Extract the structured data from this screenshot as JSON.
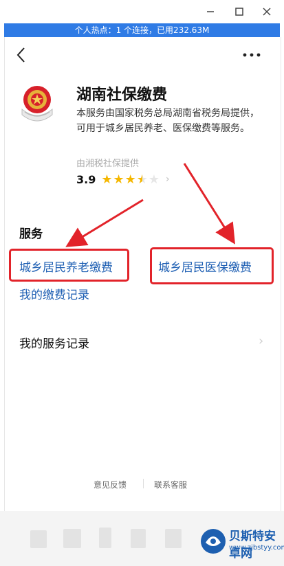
{
  "hotspot_bar": {
    "text": "个人热点：1 个连接，已用232.63M"
  },
  "app": {
    "title": "湖南社保缴费",
    "description": "本服务由国家税务总局湖南省税务局提供，可用于城乡居民养老、医保缴费等服务。",
    "provider": "由湘税社保提供",
    "rating": "3.9",
    "rating_value": 3.9,
    "rating_max": 5
  },
  "services": {
    "section_title": "服务",
    "pension_payment": "城乡居民养老缴费",
    "medical_payment": "城乡居民医保缴费",
    "payment_records": "我的缴费记录"
  },
  "service_records": {
    "label": "我的服务记录"
  },
  "footer": {
    "feedback": "意见反馈",
    "contact": "联系客服"
  },
  "watermark": {
    "name": "贝斯特安卓网",
    "url": "www.zjbstyy.com"
  },
  "colors": {
    "accent_blue": "#2f7be5",
    "link_blue": "#1e5fb3",
    "highlight_red": "#e2232a",
    "star": "#f5b700"
  }
}
